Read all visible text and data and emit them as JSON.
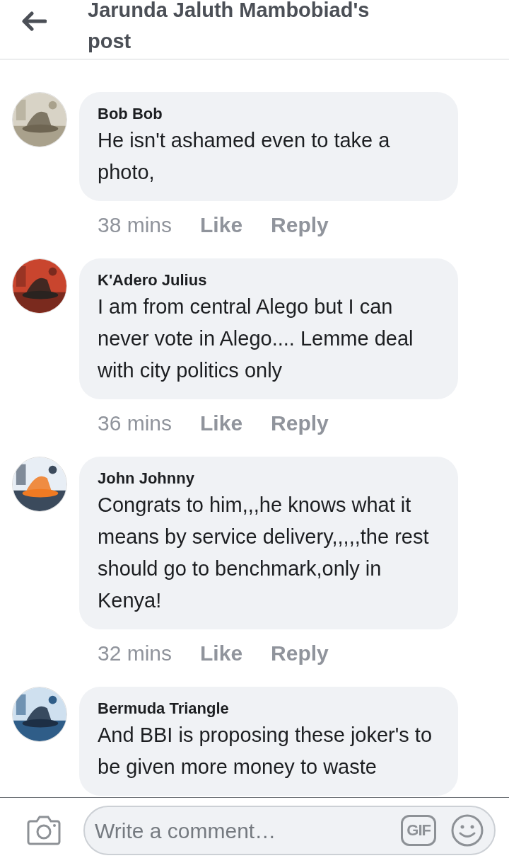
{
  "header": {
    "title": "Jarunda Jaluth Mambobiad's post"
  },
  "comments": [
    {
      "author": "Bob Bob",
      "text": "He isn't ashamed even to take a photo,",
      "time": "38 mins",
      "like": "Like",
      "reply": "Reply"
    },
    {
      "author": "K'Adero Julius",
      "text": "I am from central Alego but I can never vote in Alego.... Lemme deal with city politics only",
      "time": "36 mins",
      "like": "Like",
      "reply": "Reply"
    },
    {
      "author": "John Johnny",
      "text": "Congrats to him,,,he knows what it means by service delivery,,,,,the rest should go to benchmark,only in Kenya!",
      "time": "32 mins",
      "like": "Like",
      "reply": "Reply"
    },
    {
      "author": "Bermuda Triangle",
      "text": "And BBI is proposing these joker's to be given more money to waste"
    }
  ],
  "composer": {
    "placeholder": "Write a comment…",
    "gif": "GIF"
  }
}
